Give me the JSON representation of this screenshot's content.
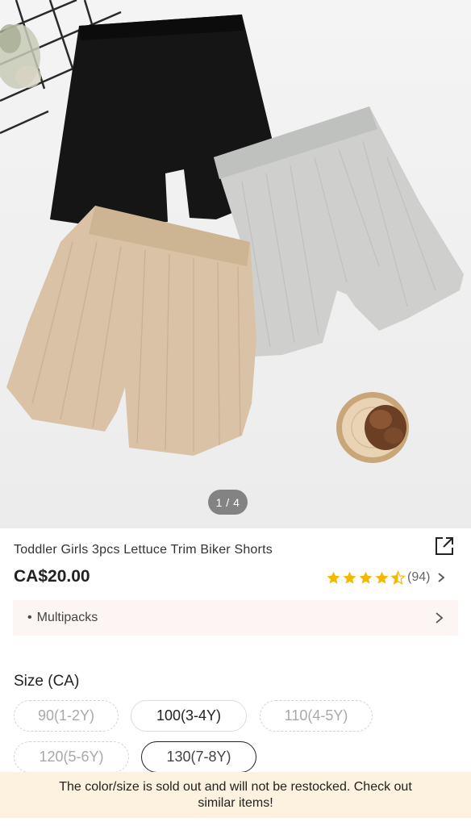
{
  "product": {
    "image_pager": "1 / 4",
    "title": "Toddler Girls 3pcs Lettuce Trim Biker Shorts",
    "price": "CA$20.00",
    "rating": {
      "stars": 4.5,
      "count_text": "(94)",
      "star_color": "#f5b800"
    },
    "image_description_icons": [
      "black-shorts",
      "grey-shorts",
      "beige-shorts",
      "pine-cone-decor",
      "wire-grid-decor"
    ]
  },
  "multipacks": {
    "bullet": "•",
    "label": "Multipacks"
  },
  "size": {
    "label": "Size (CA)",
    "options": [
      {
        "label": "90(1-2Y)",
        "state": "sold-out"
      },
      {
        "label": "100(3-4Y)",
        "state": "available"
      },
      {
        "label": "110(4-5Y)",
        "state": "sold-out"
      },
      {
        "label": "120(5-6Y)",
        "state": "sold-out"
      },
      {
        "label": "130(7-8Y)",
        "state": "selected"
      }
    ]
  },
  "toast": {
    "line1": "The color/size is sold out and will not be restocked. Check out",
    "line2": "similar items!"
  },
  "colors": {
    "accent_star": "#f5b800",
    "toast_bg": "#fdf1df",
    "multipacks_bg": "#fdf5f3"
  }
}
